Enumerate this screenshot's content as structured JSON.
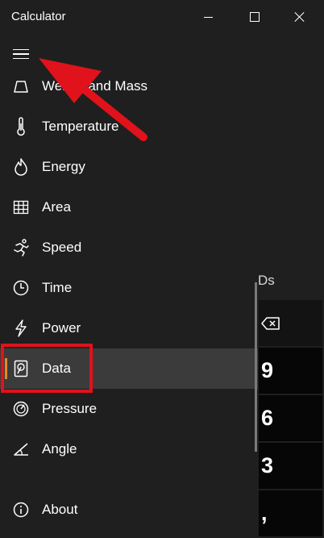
{
  "window": {
    "title": "Calculator",
    "controls": [
      "minimize-icon",
      "maximize-icon",
      "close-icon"
    ]
  },
  "nav": {
    "menu_icon": "hamburger-icon",
    "items": [
      {
        "label": "Weight and Mass",
        "icon": "weight-icon"
      },
      {
        "label": "Temperature",
        "icon": "thermometer-icon"
      },
      {
        "label": "Energy",
        "icon": "flame-icon"
      },
      {
        "label": "Area",
        "icon": "grid-icon"
      },
      {
        "label": "Speed",
        "icon": "runner-icon"
      },
      {
        "label": "Time",
        "icon": "clock-icon"
      },
      {
        "label": "Power",
        "icon": "bolt-icon"
      },
      {
        "label": "Data",
        "icon": "hard-drive-icon",
        "selected": true
      },
      {
        "label": "Pressure",
        "icon": "gauge-icon"
      },
      {
        "label": "Angle",
        "icon": "angle-icon"
      }
    ],
    "about": {
      "label": "About",
      "icon": "info-icon"
    }
  },
  "converter": {
    "unit_label": "Ds",
    "keys": [
      "⌫",
      "9",
      "6",
      "3",
      ","
    ]
  },
  "colors": {
    "background": "#1f1f1f",
    "selected_row": "#3b3b3b",
    "selection_accent": "#e48b22",
    "annotation_red": "#e0121b"
  }
}
